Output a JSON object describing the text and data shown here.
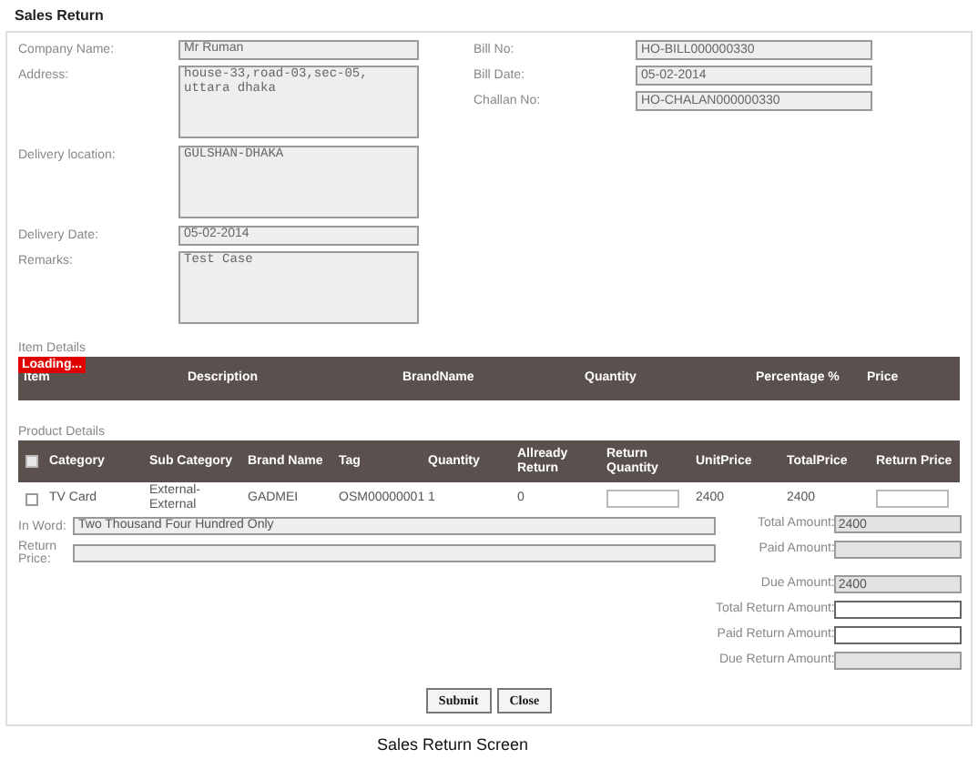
{
  "title": "Sales Return",
  "left_fields": [
    {
      "label": "Company Name:",
      "kind": "input",
      "value": "Mr Ruman"
    },
    {
      "label": "Address:",
      "kind": "textarea",
      "value": "house-33,road-03,sec-05,\nuttara dhaka"
    },
    {
      "label": "Delivery location:",
      "kind": "textarea",
      "value": "GULSHAN-DHAKA"
    },
    {
      "label": "Delivery Date:",
      "kind": "input",
      "value": "05-02-2014"
    },
    {
      "label": "Remarks:",
      "kind": "textarea",
      "value": "Test Case"
    }
  ],
  "right_fields": [
    {
      "label": "Bill No:",
      "value": "HO-BILL000000330"
    },
    {
      "label": "Bill Date:",
      "value": "05-02-2014"
    },
    {
      "label": "Challan No:",
      "value": "HO-CHALAN000000330"
    }
  ],
  "item_details": {
    "label": "Item Details",
    "loading": "Loading...",
    "columns": [
      "Item",
      "Description",
      "BrandName",
      "Quantity",
      "Percentage %",
      "Price"
    ]
  },
  "product_details": {
    "label": "Product Details",
    "header_checked": false,
    "columns": [
      "Category",
      "Sub Category",
      "Brand Name",
      "Tag",
      "Quantity",
      "Allready Return",
      "Return Quantity",
      "UnitPrice",
      "TotalPrice",
      "Return Price"
    ],
    "rows": [
      {
        "checked": false,
        "cells": [
          {
            "kind": "text",
            "value": "TV Card"
          },
          {
            "kind": "text",
            "value": "External-External"
          },
          {
            "kind": "text",
            "value": "GADMEI"
          },
          {
            "kind": "text",
            "value": "OSM00000001"
          },
          {
            "kind": "text",
            "value": "1"
          },
          {
            "kind": "text",
            "value": "0"
          },
          {
            "kind": "input"
          },
          {
            "kind": "text",
            "value": "2400"
          },
          {
            "kind": "text",
            "value": "2400"
          },
          {
            "kind": "input"
          }
        ]
      }
    ]
  },
  "in_word": {
    "label": "In Word:",
    "value": "Two Thousand Four Hundred Only"
  },
  "return_price": {
    "label": "Return Price:"
  },
  "amounts": [
    {
      "label": "Total Amount:",
      "value": "2400",
      "disabled": true
    },
    {
      "label": "Paid Amount:",
      "disabled": true
    },
    {
      "label": "Due Amount:",
      "value": "2400",
      "disabled": true
    },
    {
      "label": "Total Return Amount:",
      "disabled": false
    },
    {
      "label": "Paid Return Amount:",
      "disabled": false
    },
    {
      "label": "Due Return Amount:",
      "disabled": true
    }
  ],
  "buttons": [
    "Submit",
    "Close"
  ],
  "caption": "Sales Return Screen"
}
